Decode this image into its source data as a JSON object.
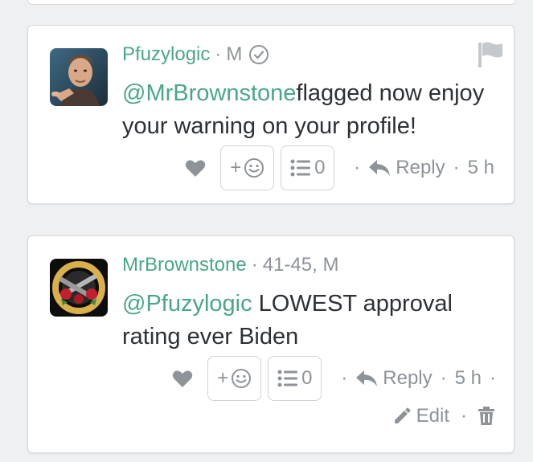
{
  "comments": [
    {
      "username": "Pfuzylogic",
      "meta_sep": "·",
      "meta": "M",
      "verified": true,
      "mention": "@MrBrownstone",
      "text": "flagged now enjoy your warning on your profile!",
      "list_count": "0",
      "reply_label": "Reply",
      "time": "5 h",
      "react_label": "+",
      "avatar_icon": "man-pointing-avatar"
    },
    {
      "username": "MrBrownstone",
      "meta_sep": "·",
      "meta": "41-45, M",
      "verified": false,
      "mention": "@Pfuzylogic",
      "text": " LOWEST approval rating ever Biden",
      "list_count": "0",
      "reply_label": "Reply",
      "time": "5 h",
      "react_label": "+",
      "edit_label": "Edit",
      "avatar_icon": "guns-n-roses-logo-avatar"
    }
  ],
  "colors": {
    "accent": "#4aa68a",
    "muted": "#8d9399",
    "text": "#2d3135",
    "background": "#eef0f2"
  }
}
